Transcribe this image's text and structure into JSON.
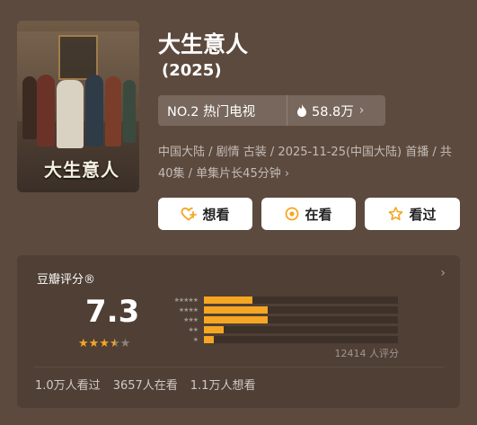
{
  "show": {
    "title": "大生意人",
    "year": "(2025)",
    "poster_title": "大生意人",
    "rank_label": "NO.2 热门电视",
    "heat": "58.8万",
    "meta_line": "中国大陆 / 剧情 古装 / 2025-11-25(中国大陆) 首播 / 共40集 / 单集片长45分钟"
  },
  "actions": {
    "want_label": "想看",
    "watching_label": "在看",
    "watched_label": "看过"
  },
  "rating": {
    "section_title": "豆瓣评分®",
    "score": "7.3",
    "stars_filled": 3.5,
    "distribution": [
      {
        "stars": "★★★★★",
        "value": 0.25
      },
      {
        "stars": "★★★★",
        "value": 0.33
      },
      {
        "stars": "★★★",
        "value": 0.33
      },
      {
        "stars": "★★",
        "value": 0.1
      },
      {
        "stars": "★",
        "value": 0.05
      }
    ],
    "votes": "12414 人评分"
  },
  "stats": {
    "watched": "1.0万人看过",
    "watching": "3657人在看",
    "want": "1.1万人想看"
  },
  "colors": {
    "background": "#5d4a3e",
    "card": "#4f3f35",
    "accent": "#f5a623"
  }
}
